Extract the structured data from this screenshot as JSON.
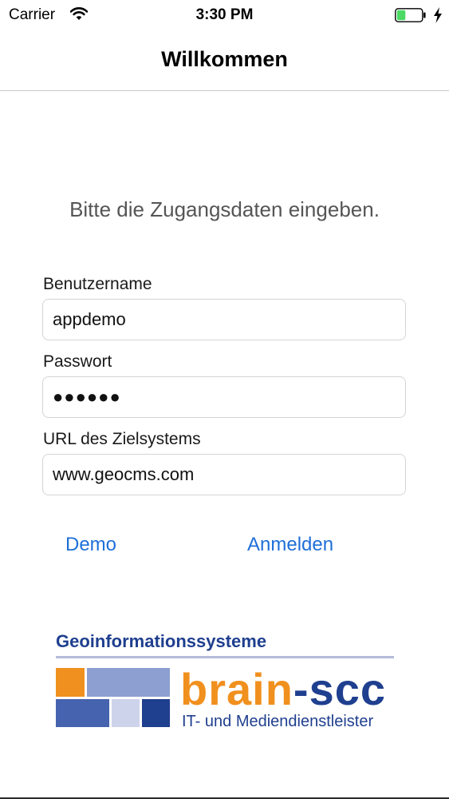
{
  "status_bar": {
    "carrier": "Carrier",
    "time": "3:30 PM",
    "battery_level_percent": 35,
    "battery_color": "#4cd964"
  },
  "nav": {
    "title": "Willkommen"
  },
  "form": {
    "instruction": "Bitte die Zugangsdaten eingeben.",
    "username_label": "Benutzername",
    "username_value": "appdemo",
    "password_label": "Passwort",
    "password_value": "●●●●●●",
    "url_label": "URL des Zielsystems",
    "url_value": "www.geocms.com"
  },
  "actions": {
    "demo_label": "Demo",
    "login_label": "Anmelden",
    "link_color": "#1e6fd9"
  },
  "logo": {
    "heading": "Geoinformationssysteme",
    "brand_main": "brain",
    "brand_suffix": "-scc",
    "tagline": "IT- und Mediendienstleister",
    "orange": "#f0901e",
    "navy": "#1f3f8f"
  }
}
